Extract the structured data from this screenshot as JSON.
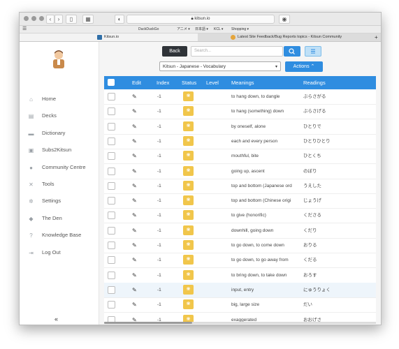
{
  "browser": {
    "url": "kitsun.io",
    "favorites": [
      "DuckDuckGo",
      "アニメ ▾",
      "日本語 ▾",
      "KCL ▾",
      "Shopping ▾"
    ],
    "tabs": [
      {
        "label": "Kitsun.io"
      },
      {
        "label": "Latest Site Feedback/Bug Reports topics - Kitsun Community"
      }
    ]
  },
  "sidebar": {
    "items": [
      {
        "label": "Home",
        "icon": "home-icon"
      },
      {
        "label": "Decks",
        "icon": "decks-icon"
      },
      {
        "label": "Dictionary",
        "icon": "book-icon"
      },
      {
        "label": "Subs2Kitsun",
        "icon": "film-icon"
      },
      {
        "label": "Community Centre",
        "icon": "community-icon"
      },
      {
        "label": "Tools",
        "icon": "tools-icon"
      },
      {
        "label": "Settings",
        "icon": "gear-icon"
      },
      {
        "label": "The Den",
        "icon": "chat-icon"
      },
      {
        "label": "Knowledge Base",
        "icon": "question-icon"
      },
      {
        "label": "Log Out",
        "icon": "logout-icon"
      }
    ],
    "collapse_label": "«"
  },
  "toolbar": {
    "back_label": "Back",
    "search_placeholder": "Search...",
    "deck_select": "Kitsun - Japanese - Vocabulary",
    "actions_label": "Actions ⌃"
  },
  "table": {
    "headers": {
      "edit": "Edit",
      "index": "Index",
      "status": "Status",
      "level": "Level",
      "meanings": "Meanings",
      "readings": "Readings"
    },
    "rows": [
      {
        "index": "-1",
        "meaning": "to hang down, to dangle",
        "reading": "ぶらさがる"
      },
      {
        "index": "-1",
        "meaning": "to hang (something) down",
        "reading": "ぶらさげる"
      },
      {
        "index": "-1",
        "meaning": "by oneself, alone",
        "reading": "ひとりで"
      },
      {
        "index": "-1",
        "meaning": "each and every person",
        "reading": "ひとりひとり"
      },
      {
        "index": "-1",
        "meaning": "mouthful, bite",
        "reading": "ひとくち"
      },
      {
        "index": "-1",
        "meaning": "going up, ascent",
        "reading": "のぼり"
      },
      {
        "index": "-1",
        "meaning": "top and bottom (Japanese ord",
        "reading": "うえした"
      },
      {
        "index": "-1",
        "meaning": "top and bottom (Chinese origi",
        "reading": "じょうげ"
      },
      {
        "index": "-1",
        "meaning": "to give (honorific)",
        "reading": "くださる"
      },
      {
        "index": "-1",
        "meaning": "downhill, going down",
        "reading": "くだり"
      },
      {
        "index": "-1",
        "meaning": "to go down, to come down",
        "reading": "おりる"
      },
      {
        "index": "-1",
        "meaning": "to go down, to go away from",
        "reading": "くだる"
      },
      {
        "index": "-1",
        "meaning": "to bring down, to take down",
        "reading": "おろす"
      },
      {
        "index": "-1",
        "meaning": "input, entry",
        "reading": "にゅうりょく"
      },
      {
        "index": "-1",
        "meaning": "big, large size",
        "reading": "だい"
      },
      {
        "index": "-1",
        "meaning": "exaggerated",
        "reading": "おおげさ"
      }
    ]
  },
  "colors": {
    "accent": "#2f8de0",
    "status": "#f1c64b",
    "back_button": "#2f3338"
  }
}
